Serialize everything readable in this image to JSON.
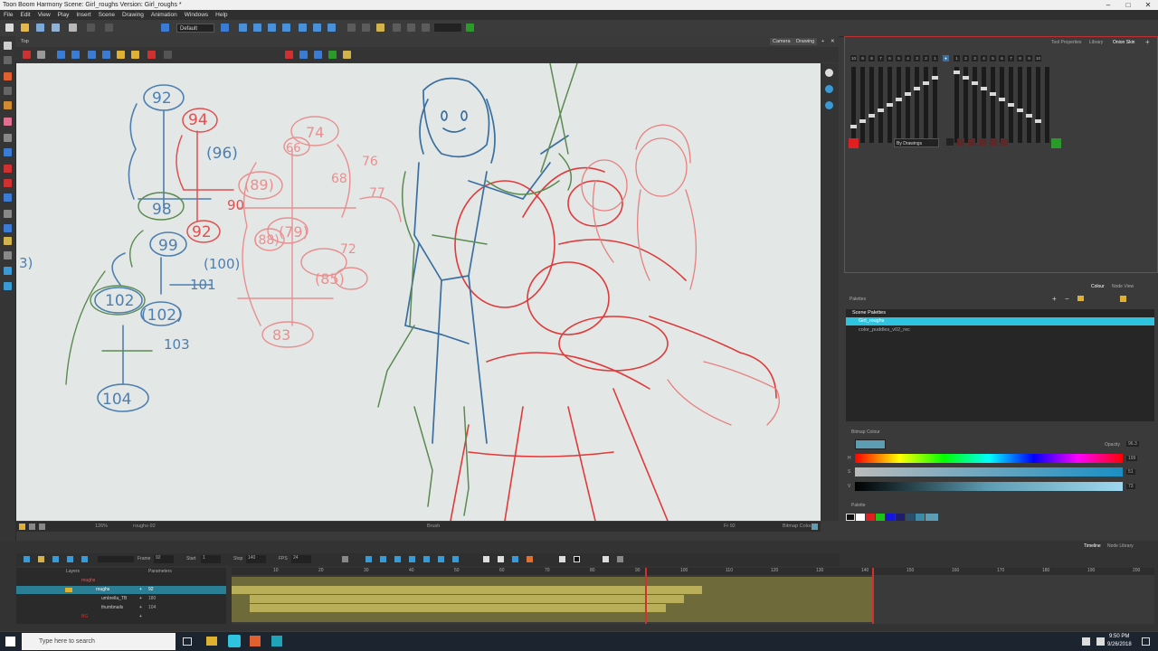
{
  "window": {
    "title": "Toon Boom Harmony Scene: Girl_roughs Version: Girl_roughs *"
  },
  "menu": [
    "File",
    "Edit",
    "View",
    "Play",
    "Insert",
    "Scene",
    "Drawing",
    "Animation",
    "Windows",
    "Help"
  ],
  "toolbar": {
    "workspace": "Default"
  },
  "view": {
    "tab_label": "Top",
    "tabs": [
      "Camera",
      "Drawing"
    ],
    "status_zoom": "126%",
    "status_drawing": "roughs-92",
    "status_tool": "Brush",
    "status_frame": "Fr 92",
    "status_colour": "Bitmap Colour"
  },
  "canvas": {
    "blue_numbers": [
      "92",
      "(96)",
      "98",
      "99",
      "(100)",
      "101",
      "102",
      "(102)",
      "103",
      "104",
      "3)"
    ],
    "red_numbers": [
      "94",
      "92",
      "90",
      "74",
      "76",
      "68",
      "(89)",
      "66",
      "77",
      "(79)",
      "72",
      "(88)",
      "(85)",
      "83"
    ]
  },
  "onion": {
    "tabs": [
      "Tool Properties",
      "Library",
      "Onion Skin"
    ],
    "before_nums": [
      "10",
      "9",
      "8",
      "7",
      "6",
      "5",
      "4",
      "3",
      "2",
      "1"
    ],
    "after_nums": [
      "1",
      "2",
      "3",
      "4",
      "5",
      "6",
      "7",
      "8",
      "9",
      "10"
    ],
    "mode": "By Drawings",
    "before_color": "#e02020",
    "after_color": "#2a9a2a"
  },
  "colour_panel": {
    "tabs": [
      "Colour",
      "Node View"
    ],
    "palettes_label": "Palettes",
    "scene_palettes_label": "Scene Palettes",
    "palettes": [
      "Girl_roughs",
      "color_puddles_v02_rec"
    ],
    "bitmap_label": "Bitmap Colour",
    "opacity_label": "Opacity",
    "opacity_value": "96.3",
    "h_label": "H",
    "h_value": "199",
    "s_label": "S",
    "s_value": "51",
    "v_label": "V",
    "v_value": "73",
    "swatch_color": "#5d9db3",
    "palette_section_label": "Palette",
    "swatches": [
      "#111111",
      "#ffffff",
      "#e02020",
      "#19c419",
      "#1515e0",
      "#1e1e6e",
      "#2a4f6a",
      "#3a8aa8",
      "#5d9db3"
    ]
  },
  "timeline": {
    "tabs": [
      "Timeline",
      "Node Library"
    ],
    "frame_label": "Frame",
    "frame_value": "92",
    "start_label": "Start",
    "start_value": "1",
    "stop_label": "Stop",
    "stop_value": "140",
    "fps_label": "FPS",
    "fps_value": "24",
    "layers_header": "Layers",
    "params_header": "Parameters",
    "layers": [
      {
        "name": "roughs",
        "level": 0,
        "color": "#cc6666"
      },
      {
        "name": "roughs",
        "level": 1,
        "color": "#2ec4e0",
        "selected": true,
        "value": "92"
      },
      {
        "name": "umbrella_TB",
        "level": 1,
        "color": "#cc6666",
        "value": "180"
      },
      {
        "name": "thumbnails",
        "level": 1,
        "color": "#cc6666",
        "value": "104"
      },
      {
        "name": "BG",
        "level": 0,
        "color": "#cc3333"
      }
    ],
    "ruler": [
      "10",
      "20",
      "30",
      "40",
      "50",
      "60",
      "70",
      "80",
      "90",
      "100",
      "110",
      "120",
      "130",
      "140",
      "150",
      "160",
      "170",
      "180",
      "190",
      "200"
    ]
  },
  "taskbar": {
    "search_placeholder": "Type here to search",
    "time": "9:50 PM",
    "date": "9/26/2018"
  }
}
